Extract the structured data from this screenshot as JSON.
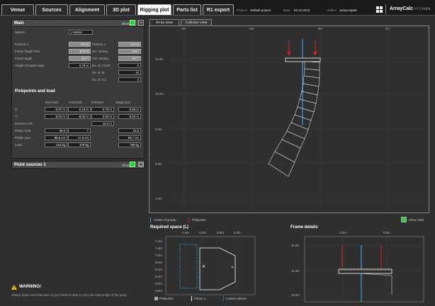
{
  "tabs": [
    "Venue",
    "Sources",
    "Alignment",
    "3D plot",
    "Rigging plot",
    "Parts list",
    "R1 export"
  ],
  "active_tab": "Rigging plot",
  "project": {
    "label": "Project:",
    "value": "Default project"
  },
  "date": {
    "label": "Date:",
    "value": "04.12.2013"
  },
  "author": {
    "label": "Author:",
    "value": "array-expert"
  },
  "brand": {
    "name": "ArrayCalc",
    "version": "V7.5.R008"
  },
  "main": {
    "title": "Main",
    "show_label": "Show",
    "system_label": "System",
    "system_value": "J-Series",
    "position_x_label": "Position x:",
    "position_x": "0.0 m",
    "position_y_label": "Position y:",
    "position_y": "-8.0 m",
    "frame_height_label": "Frame height front:",
    "frame_height": "11.0 m",
    "hor_aiming_label": "Hor. aiming:",
    "hor_aiming": "0.0 °",
    "frame_angle_label": "Frame angle:",
    "frame_angle": "-0.7 °",
    "vert_aiming_label": "Vert. aiming:",
    "vert_aiming": "-0.7 °",
    "lowest_edge_label": "Height of lowest edge:",
    "lowest_edge": "6.79 m",
    "no_sub_label": "No. of J-SUB:",
    "no_sub": "0",
    "no_8_label": "No. of J8:",
    "no_8": "10",
    "no_12_label": "No. of J12:",
    "no_12": "2"
  },
  "pickpoints": {
    "title": "Pickpoints and load",
    "headers": [
      "Rear pick",
      "Front pick",
      "Distance",
      "Single pick"
    ],
    "rows": [
      {
        "label": "X:",
        "cells": [
          "-0.97 m",
          "-0.18 m",
          "0.79 m",
          "-0.58 m"
        ]
      },
      {
        "label": "Y:",
        "cells": [
          "-8.00 m",
          "-8.00 m",
          "0.00 m",
          "-8.00 m"
        ]
      },
      {
        "label": "Distance L/R:",
        "cells": [
          "",
          "",
          "18.0 m",
          ""
        ]
      },
      {
        "label": "Pickpt. hole:",
        "cells": [
          "38.5",
          "7",
          "",
          "23.5"
        ]
      },
      {
        "label": "Pickpt. pos.:",
        "cells": [
          "96.5 cm",
          "17.8 cm",
          "",
          "58.7 cm"
        ]
      },
      {
        "label": "Load:",
        "cells": [
          "410 kg",
          "379 kg",
          "",
          "789 kg"
        ]
      }
    ]
  },
  "point_sources": {
    "title": "Point sources 1",
    "show_label": "Show"
  },
  "warning": {
    "title": "WARNING!",
    "text": "Always make sure that each of your hoists is able to carry the total weight of the array."
  },
  "view_tabs": [
    "Array view",
    "Collision view"
  ],
  "plot": {
    "x_ticks": [
      "-4m",
      "-2m",
      "0m",
      "2m"
    ],
    "y_ticks": [
      "11.0m",
      "10.0m",
      "9.0m",
      "8.0m",
      "7.0m"
    ]
  },
  "legend": {
    "cog": "Center of gravity",
    "pick": "Pickpoints",
    "solid": "Show solid"
  },
  "required_space": {
    "title": "Required space (L)",
    "x_ticks": [
      "-1.5m",
      "-1.0m",
      "-0.5m",
      "0.0m"
    ],
    "y_ticks": [
      "-7.4m",
      "-7.6m",
      "-7.8m",
      "-8.0m",
      "-8.2m",
      "-8.4m",
      "-8.6m",
      "-8.8m"
    ],
    "legend": [
      "Pickpoints",
      "Frame 1",
      "Lowest cabinet"
    ]
  },
  "frame_details": {
    "title": "Frame details",
    "x_ticks": [
      "-1.0m",
      "0.0m"
    ],
    "y_ticks": [
      "11.5m",
      "11.0m",
      "10.5m"
    ]
  },
  "colors": {
    "cog": "#3aa0e8",
    "pick": "#d02020",
    "show_green": "#2ecc40"
  }
}
